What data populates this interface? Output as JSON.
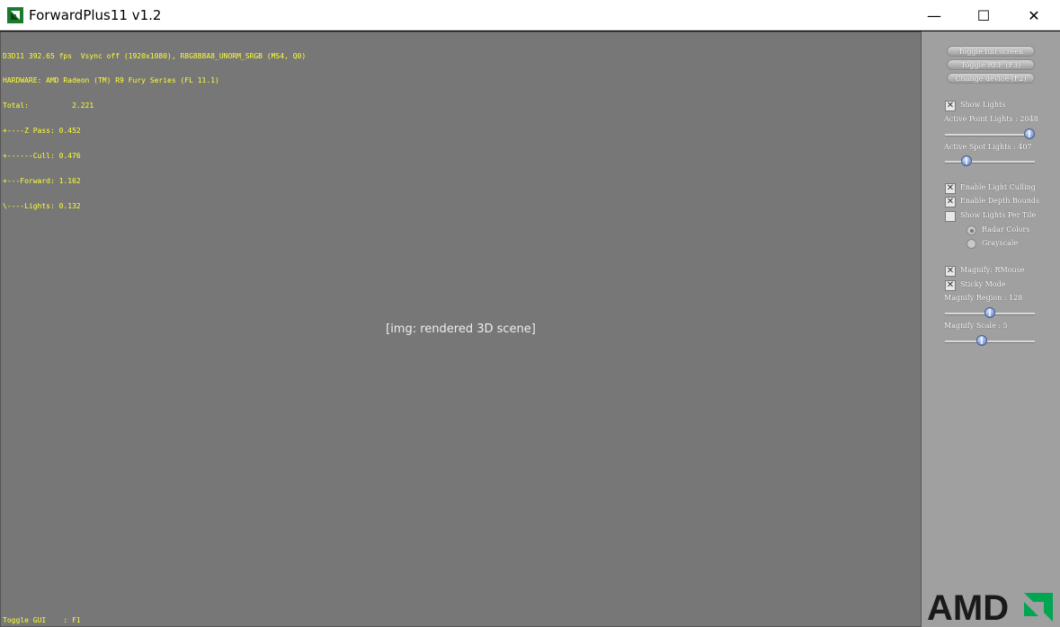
{
  "window": {
    "title": "ForwardPlus11 v1.2",
    "controls": {
      "minimize": "—",
      "maximize": "☐",
      "close": "✕"
    }
  },
  "hud": {
    "lines": [
      "D3D11 392.65 fps  Vsync off (1920x1080), R8G8B8A8_UNORM_SRGB (MS4, Q0)",
      "HARDWARE: AMD Radeon (TM) R9 Fury Series (FL 11.1)",
      "Total:          2.221",
      "+----Z Pass: 0.452",
      "+------Cull: 0.476",
      "+---Forward: 1.162",
      "\\----Lights: 0.132"
    ],
    "toggle_gui": "Toggle GUI    : F1",
    "color": "#ffff33"
  },
  "panel": {
    "buttons": {
      "toggle_full_screen": "Toggle full screen",
      "toggle_ref": "Toggle REF (F3)",
      "change_device": "Change device (F2)"
    },
    "show_lights": {
      "label": "Show Lights",
      "checked": true
    },
    "active_point_lights": {
      "label": "Active Point Lights : 2048",
      "level": 1.0
    },
    "active_spot_lights": {
      "label": "Active Spot Lights : 407",
      "level": 0.2
    },
    "enable_light_culling": {
      "label": "Enable Light Culling",
      "checked": true
    },
    "enable_depth_bounds": {
      "label": "Enable Depth Bounds",
      "checked": true
    },
    "show_lights_per_tile": {
      "label": "Show Lights Per Tile",
      "checked": false
    },
    "radar_colors": {
      "label": "Radar Colors",
      "selected": true
    },
    "grayscale": {
      "label": "Grayscale",
      "selected": false
    },
    "magnify": {
      "label": "Magnify: RMouse",
      "checked": true
    },
    "sticky_mode": {
      "label": "Sticky Mode",
      "checked": true
    },
    "magnify_region": {
      "label": "Magnify Region : 128",
      "level": 0.5
    },
    "magnify_scale": {
      "label": "Magnify Scale : 5",
      "level": 0.4
    },
    "logo": "AMD",
    "background": "#a0a0a0",
    "slider_color": "#5a78b8"
  },
  "colors": {
    "amd_logo": "#1a1a1a",
    "amd_green": "#00a651"
  }
}
